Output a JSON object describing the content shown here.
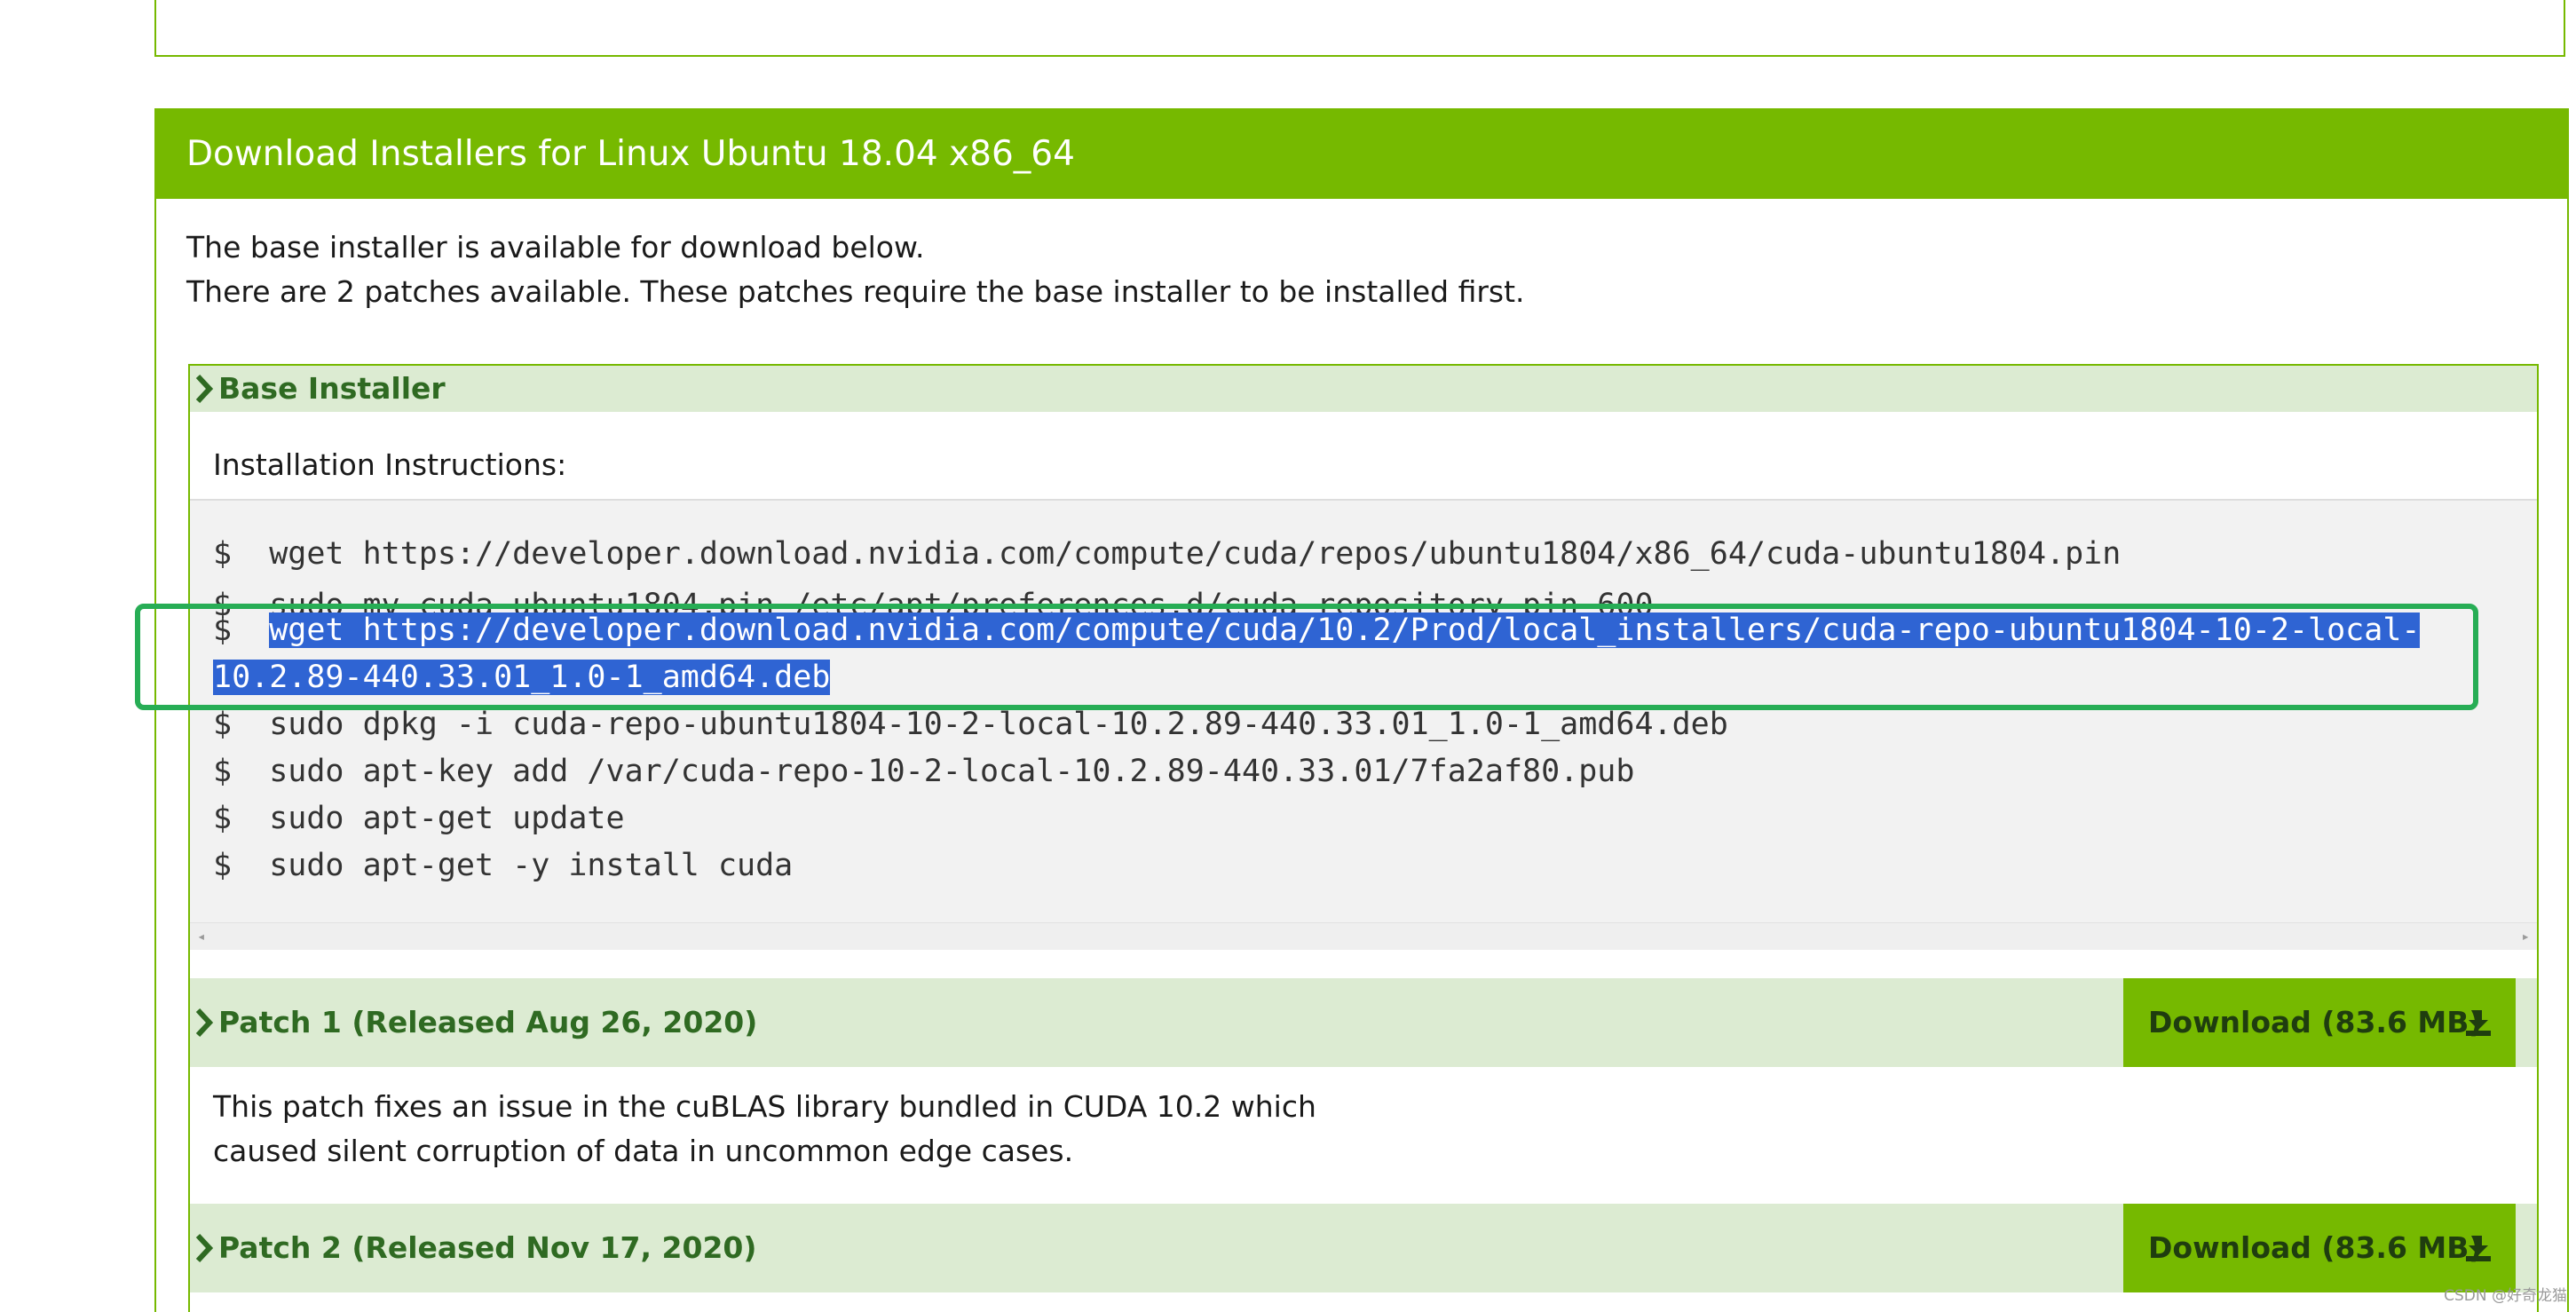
{
  "section": {
    "title": "Download Installers for Linux Ubuntu 18.04 x86_64",
    "intro_line1": "The base installer is available for download below.",
    "intro_line2": "There are 2 patches available. These patches require the base installer to be installed first."
  },
  "base_installer": {
    "title": "Base Installer",
    "instructions_label": "Installation Instructions:",
    "commands": {
      "c1": "$  wget https://developer.download.nvidia.com/compute/cuda/repos/ubuntu1804/x86_64/cuda-ubuntu1804.pin",
      "c2": "$  sudo mv cuda-ubuntu1804.pin /etc/apt/preferences.d/cuda-repository-pin-600",
      "c3_prompt": "$  ",
      "c3_selected_part1": "wget https://developer.download.nvidia.com/compute/cuda/10.2/Prod/local_installers/cuda-repo-ubuntu1804-10-2-local-",
      "c3_selected_part2": "10.2.89-440.33.01_1.0-1_amd64.deb",
      "c4": "$  sudo dpkg -i cuda-repo-ubuntu1804-10-2-local-10.2.89-440.33.01_1.0-1_amd64.deb",
      "c5": "$  sudo apt-key add /var/cuda-repo-10-2-local-10.2.89-440.33.01/7fa2af80.pub",
      "c6": "$  sudo apt-get update",
      "c7": "$  sudo apt-get -y install cuda"
    }
  },
  "patches": [
    {
      "title": "Patch 1 (Released Aug 26, 2020)",
      "download_label": "Download (83.6 MB)",
      "desc_line1": "This patch fixes an issue in the cuBLAS library bundled in CUDA 10.2 which",
      "desc_line2": "caused silent corruption of data in uncommon edge cases."
    },
    {
      "title": "Patch 2 (Released Nov 17, 2020)",
      "download_label": "Download (83.6 MB)"
    }
  ],
  "watermark": "CSDN @好奇龙猫",
  "icons": {
    "chevron": "chevron-right-icon",
    "download": "download-icon",
    "scroll_left": "scroll-left-arrow-icon",
    "scroll_right": "scroll-right-arrow-icon"
  },
  "colors": {
    "brand_green": "#76b900",
    "light_green": "#dcebd2",
    "selection_blue": "#2f64d3",
    "annotation_green": "#27ad55"
  }
}
